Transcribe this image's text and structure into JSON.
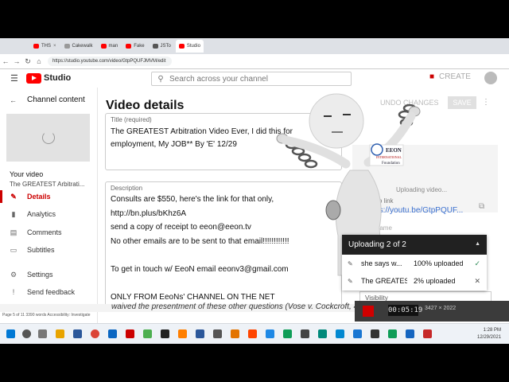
{
  "browser": {
    "tabs": [
      "THS",
      "Cakewalk",
      "man",
      "Fake",
      "JSTo",
      "Studio"
    ],
    "url": "https://studio.youtube.com/video/GtpPQUFJMVM/edit"
  },
  "header": {
    "logo_label": "Studio",
    "search_placeholder": "Search across your channel",
    "create_label": "CREATE"
  },
  "sidebar": {
    "title": "Channel content",
    "your_video_label": "Your video",
    "video_title": "The GREATEST Arbitrati...",
    "items": [
      {
        "label": "Details",
        "icon": "pencil-icon"
      },
      {
        "label": "Analytics",
        "icon": "bar-chart-icon"
      },
      {
        "label": "Comments",
        "icon": "comment-icon"
      },
      {
        "label": "Subtitles",
        "icon": "subtitles-icon"
      },
      {
        "label": "Settings",
        "icon": "gear-icon"
      },
      {
        "label": "Send feedback",
        "icon": "feedback-icon"
      }
    ]
  },
  "main": {
    "heading": "Video details",
    "undo_label": "UNDO CHANGES",
    "save_label": "SAVE",
    "title_label": "Title (required)",
    "title_text": "The GREATEST Arbitration Video Ever, I did this for employment, My JOB** By 'E' 12/29",
    "description_label": "Description",
    "description_lines": [
      "Consults are $550, here's the link for that only,",
      "http://bn.plus/bKhz6A",
      "send a copy of receipt to eeon@eeon.tv",
      "No other emails are to be sent to that email!!!!!!!!!!!!",
      "",
      "To get in touch w/ EeoN email eeonv3@gmail.com",
      "",
      "ONLY FROM EeoNs' CHANNEL ON THE NET"
    ]
  },
  "right_panel": {
    "uploading_text": "Uploading video...",
    "video_link_label": "Video link",
    "video_link": "https://youtu.be/GtpPQUF...",
    "filename_label": "Filename",
    "visibility_label": "Visibility"
  },
  "upload_dialog": {
    "title": "Uploading 2 of 2",
    "items": [
      {
        "name": "she says w...",
        "status": "100% uploaded",
        "state": "done"
      },
      {
        "name": "The GREATES...",
        "status": "2% uploaded",
        "state": "in-progress"
      }
    ]
  },
  "word_doc": {
    "body_text": "waived the presentment of these other questions (Vose v. Cockcroft, 44",
    "status": "Page 5 of 11   3390 words   Accessibility: Investigate"
  },
  "recorder": {
    "time": "00:05:19",
    "resolution": "3427 × 2022"
  },
  "taskbar": {
    "time": "1:28 PM",
    "date": "12/29/2021"
  },
  "overlay": {
    "org_name": "EEON",
    "org_sub": "INTERNATIONAL",
    "org_foundation": "Foundation"
  }
}
